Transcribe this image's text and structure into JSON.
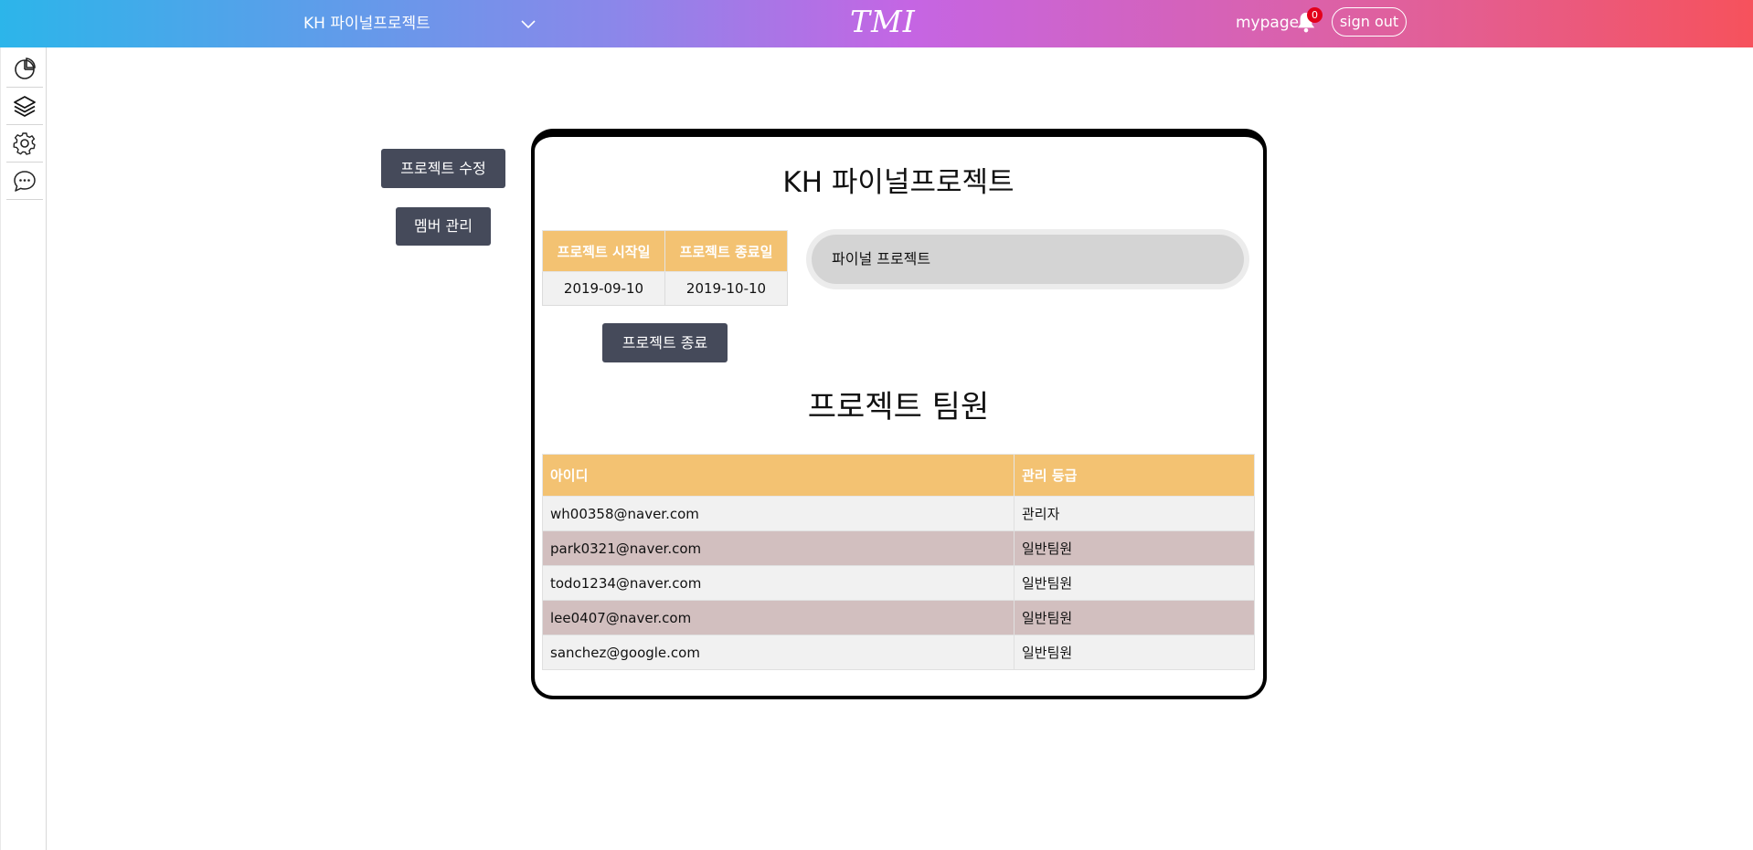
{
  "header": {
    "project_name": "KH 파이널프로젝트",
    "logo": "TMI",
    "mypage_label": "mypage",
    "notification_count": "0",
    "signout_label": "sign out"
  },
  "sidebar": {
    "items": [
      {
        "icon": "pie-chart-icon"
      },
      {
        "icon": "layers-icon"
      },
      {
        "icon": "gear-icon"
      },
      {
        "icon": "chat-bubble-icon"
      }
    ]
  },
  "actions": {
    "edit_project_label": "프로젝트 수정",
    "manage_members_label": "멤버 관리"
  },
  "project": {
    "title": "KH 파이널프로젝트",
    "start_header": "프로젝트 시작일",
    "end_header": "프로젝트 종료일",
    "start_date": "2019-09-10",
    "end_date": "2019-10-10",
    "description": "파이널 프로젝트",
    "end_button_label": "프로젝트 종료"
  },
  "members": {
    "title": "프로젝트 팀원",
    "columns": [
      "아이디",
      "관리 등급"
    ],
    "rows": [
      {
        "id": "wh00358@naver.com",
        "grade": "관리자"
      },
      {
        "id": "park0321@naver.com",
        "grade": "일반팀원"
      },
      {
        "id": "todo1234@naver.com",
        "grade": "일반팀원"
      },
      {
        "id": "lee0407@naver.com",
        "grade": "일반팀원"
      },
      {
        "id": "sanchez@google.com",
        "grade": "일반팀원"
      }
    ]
  },
  "colors": {
    "header_gradient_start": "#2cb5ea",
    "header_gradient_end": "#f6525c",
    "table_header": "#f3c272",
    "button_dark": "#454a5a",
    "row_alt": "#d2bfbf"
  }
}
